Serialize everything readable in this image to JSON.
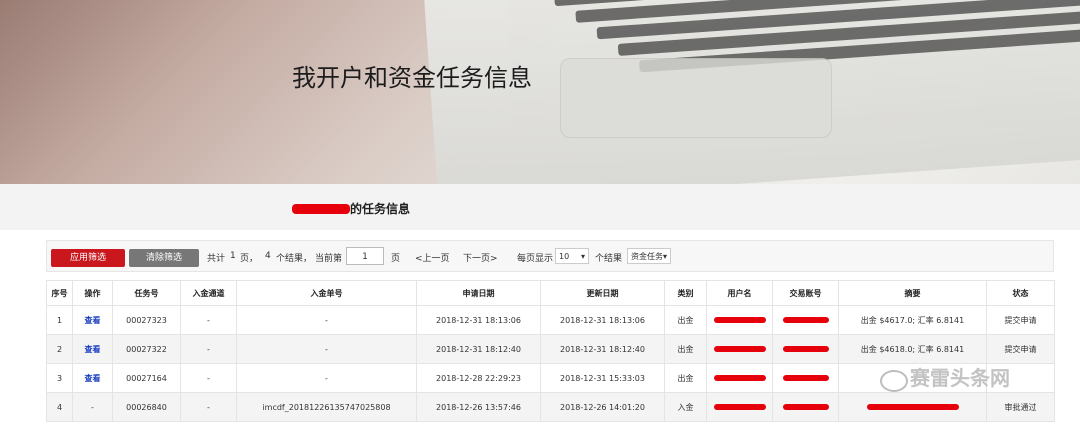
{
  "hero": {
    "title": "我开户和资金任务信息"
  },
  "section": {
    "title_suffix": "的任务信息"
  },
  "toolbar": {
    "apply_label": "应用筛选",
    "clear_label": "清除筛选",
    "summary_prefix": "共计",
    "total_pages": "1",
    "pages_unit": "页，",
    "total_results": "4",
    "results_unit": "个结果，",
    "current_label": "当前第",
    "current_page": "1",
    "page_unit": "页",
    "prev_label": "<上一页",
    "next_label": "下一页>",
    "per_page_label": "每页显示",
    "per_page_value": "10",
    "per_page_unit": "个结果",
    "filter_value": "资金任务"
  },
  "table": {
    "headers": [
      "序号",
      "操作",
      "任务号",
      "入金通道",
      "入金单号",
      "申请日期",
      "更新日期",
      "类别",
      "用户名",
      "交易账号",
      "摘要",
      "状态"
    ],
    "rows": [
      {
        "no": "1",
        "op": "查看",
        "task": "00027323",
        "channel": "-",
        "order": "-",
        "applied": "2018-12-31 18:13:06",
        "updated": "2018-12-31 18:13:06",
        "type": "出金",
        "summary": "出金 $4617.0; 汇率 6.8141",
        "status": "提交申请"
      },
      {
        "no": "2",
        "op": "查看",
        "task": "00027322",
        "channel": "-",
        "order": "-",
        "applied": "2018-12-31 18:12:40",
        "updated": "2018-12-31 18:12:40",
        "type": "出金",
        "summary": "出金 $4618.0; 汇率 6.8141",
        "status": "提交申请"
      },
      {
        "no": "3",
        "op": "查看",
        "task": "00027164",
        "channel": "-",
        "order": "-",
        "applied": "2018-12-28 22:29:23",
        "updated": "2018-12-31 15:33:03",
        "type": "出金",
        "summary": "",
        "status": ""
      },
      {
        "no": "4",
        "op": "-",
        "task": "00026840",
        "channel": "-",
        "order": "imcdf_20181226135747025808",
        "applied": "2018-12-26 13:57:46",
        "updated": "2018-12-26 14:01:20",
        "type": "入金",
        "summary": "",
        "status": "审批通过"
      }
    ]
  },
  "watermark": {
    "text": "赛雷头条网"
  },
  "colors": {
    "accent_red": "#c9171d",
    "redaction": "#e5000c",
    "link_blue": "#1a3fbf"
  }
}
